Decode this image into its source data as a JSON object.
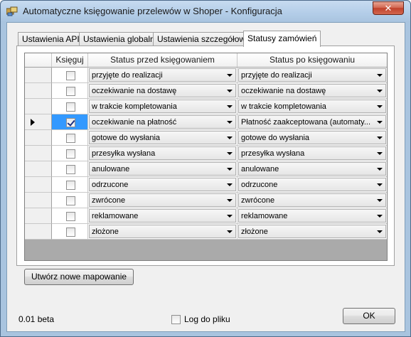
{
  "window": {
    "title": "Automatyczne księgowanie przelewów w Shoper - Konfiguracja",
    "close_glyph": "✕"
  },
  "tabs": [
    {
      "label": "Ustawienia API"
    },
    {
      "label": "Ustawienia globalne"
    },
    {
      "label": "Ustawienia szczegółowe"
    },
    {
      "label": "Statusy zamówień",
      "active": true
    }
  ],
  "grid": {
    "columns": {
      "book": "Księguj",
      "before": "Status przed księgowaniem",
      "after": "Status po księgowaniu"
    },
    "rows": [
      {
        "checked": false,
        "before": "przyjęte do realizacji",
        "after": "przyjęte do realizacji"
      },
      {
        "checked": false,
        "before": "oczekiwanie na dostawę",
        "after": "oczekiwanie na dostawę"
      },
      {
        "checked": false,
        "before": "w trakcie kompletowania",
        "after": "w trakcie kompletowania"
      },
      {
        "checked": true,
        "current": true,
        "before": "oczekiwanie na płatność",
        "after": "Płatność zaakceptowana (automaty..."
      },
      {
        "checked": false,
        "before": "gotowe do wysłania",
        "after": "gotowe do wysłania"
      },
      {
        "checked": false,
        "before": "przesyłka wysłana",
        "after": "przesyłka wysłana"
      },
      {
        "checked": false,
        "before": "anulowane",
        "after": "anulowane"
      },
      {
        "checked": false,
        "before": "odrzucone",
        "after": "odrzucone"
      },
      {
        "checked": false,
        "before": "zwrócone",
        "after": "zwrócone"
      },
      {
        "checked": false,
        "before": "reklamowane",
        "after": "reklamowane"
      },
      {
        "checked": false,
        "before": "złożone",
        "after": "złożone"
      }
    ]
  },
  "buttons": {
    "new_mapping": "Utwórz nowe mapowanie",
    "ok": "OK"
  },
  "footer": {
    "version": "0.01 beta",
    "log_label": "Log do pliku",
    "log_checked": false
  }
}
